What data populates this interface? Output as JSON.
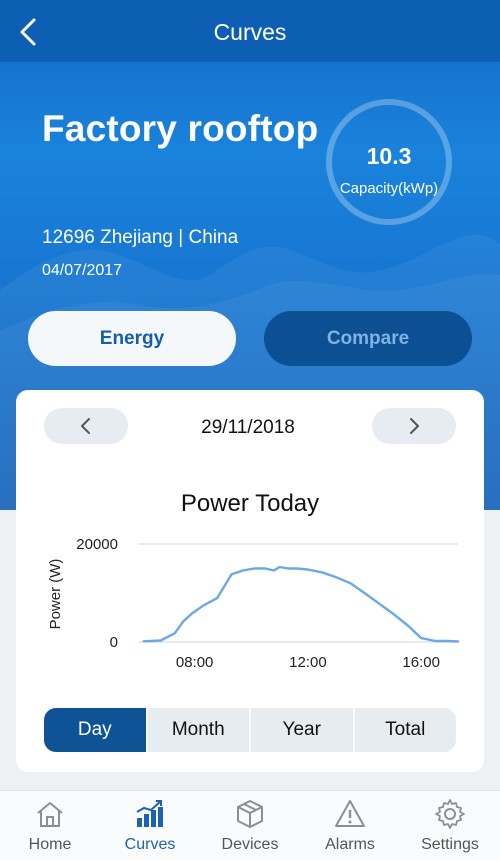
{
  "header": {
    "title": "Curves",
    "back_icon": "chevron-left-icon"
  },
  "site": {
    "name": "Factory rooftop",
    "location": "12696 Zhejiang | China",
    "date": "04/07/2017",
    "capacity_value": "10.3",
    "capacity_label": "Capacity(kWp)"
  },
  "segments": {
    "energy_label": "Energy",
    "compare_label": "Compare",
    "selected": "Energy"
  },
  "card": {
    "date": "29/11/2018",
    "prev_icon": "chevron-left-icon",
    "next_icon": "chevron-right-icon",
    "range_tabs": [
      "Day",
      "Month",
      "Year",
      "Total"
    ],
    "selected_range": "Day"
  },
  "chart_data": {
    "type": "line",
    "title": "Power Today",
    "xlabel": "",
    "ylabel": "Power (W)",
    "xticks": [
      "08:00",
      "12:00",
      "16:00"
    ],
    "yticks": [
      "0",
      "20000"
    ],
    "xlim": [
      6.0,
      17.3
    ],
    "ylim": [
      0,
      20000
    ],
    "grid": "horizontal",
    "series": [
      {
        "color": "#6aa8e6",
        "x": [
          6.2,
          6.8,
          7.3,
          7.6,
          7.9,
          8.3,
          8.8,
          9.3,
          9.7,
          10.1,
          10.5,
          10.8,
          11.0,
          11.3,
          11.6,
          12.0,
          12.5,
          13.0,
          13.5,
          14.0,
          14.5,
          15.0,
          15.5,
          16.0,
          16.5,
          16.9,
          17.3
        ],
        "y": [
          150,
          300,
          1800,
          4200,
          5800,
          7400,
          9000,
          13800,
          14600,
          15000,
          15000,
          14600,
          15300,
          15000,
          15000,
          14800,
          14200,
          13200,
          12000,
          10000,
          7900,
          5800,
          3500,
          800,
          200,
          200,
          100
        ]
      }
    ]
  },
  "bottom_nav": {
    "items": [
      {
        "label": "Home",
        "icon": "home-icon"
      },
      {
        "label": "Curves",
        "icon": "curves-chart-icon"
      },
      {
        "label": "Devices",
        "icon": "devices-box-icon"
      },
      {
        "label": "Alarms",
        "icon": "alarm-warning-icon"
      },
      {
        "label": "Settings",
        "icon": "settings-gear-icon"
      }
    ],
    "active": "Curves"
  },
  "colors": {
    "header": "#0d5fb3",
    "accent": "#1a62b8",
    "active_tab": "#0f5397",
    "compare_bg": "#0c4f93",
    "line": "#6aa8e6"
  }
}
